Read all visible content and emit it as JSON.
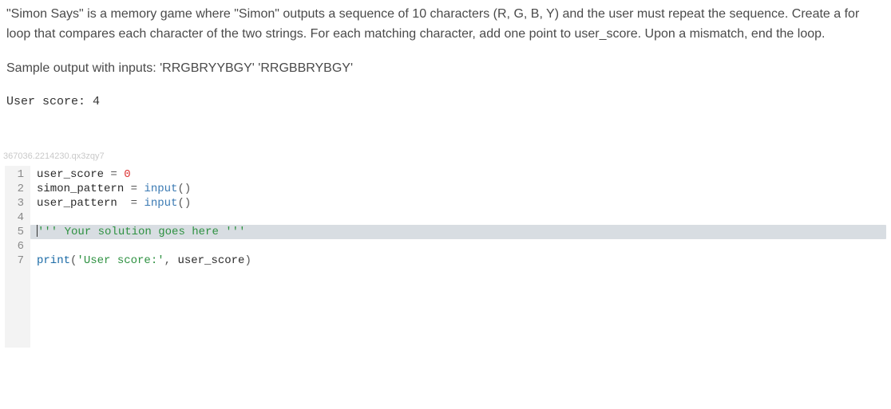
{
  "description": {
    "paragraph": "\"Simon Says\" is a memory game where \"Simon\" outputs a sequence of 10 characters (R, G, B, Y) and the user must repeat the sequence. Create a for loop that compares each character of the two strings. For each matching character, add one point to user_score. Upon a mismatch, end the loop.",
    "sample_label": "Sample output with inputs: 'RRGBRYYBGY' 'RRGBBRYBGY'",
    "sample_output": "User score: 4"
  },
  "watermark": "367036.2214230.qx3zqy7",
  "code": {
    "lines": {
      "l1": {
        "a": "user_score",
        "b": "=",
        "c": "0"
      },
      "l2": {
        "a": "simon_pattern",
        "b": "=",
        "c": "input",
        "d": "()"
      },
      "l3": {
        "a": "user_pattern",
        "b": "=",
        "c": "input",
        "d": "()"
      },
      "l5": {
        "a": "'''",
        "b": " Your solution goes here ",
        "c": "'''"
      },
      "l7": {
        "a": "print",
        "b": "(",
        "c": "'User score:'",
        "d": ",",
        "e": " user_score",
        "f": ")"
      }
    },
    "line_numbers": [
      "1",
      "2",
      "3",
      "4",
      "5",
      "6",
      "7"
    ]
  }
}
